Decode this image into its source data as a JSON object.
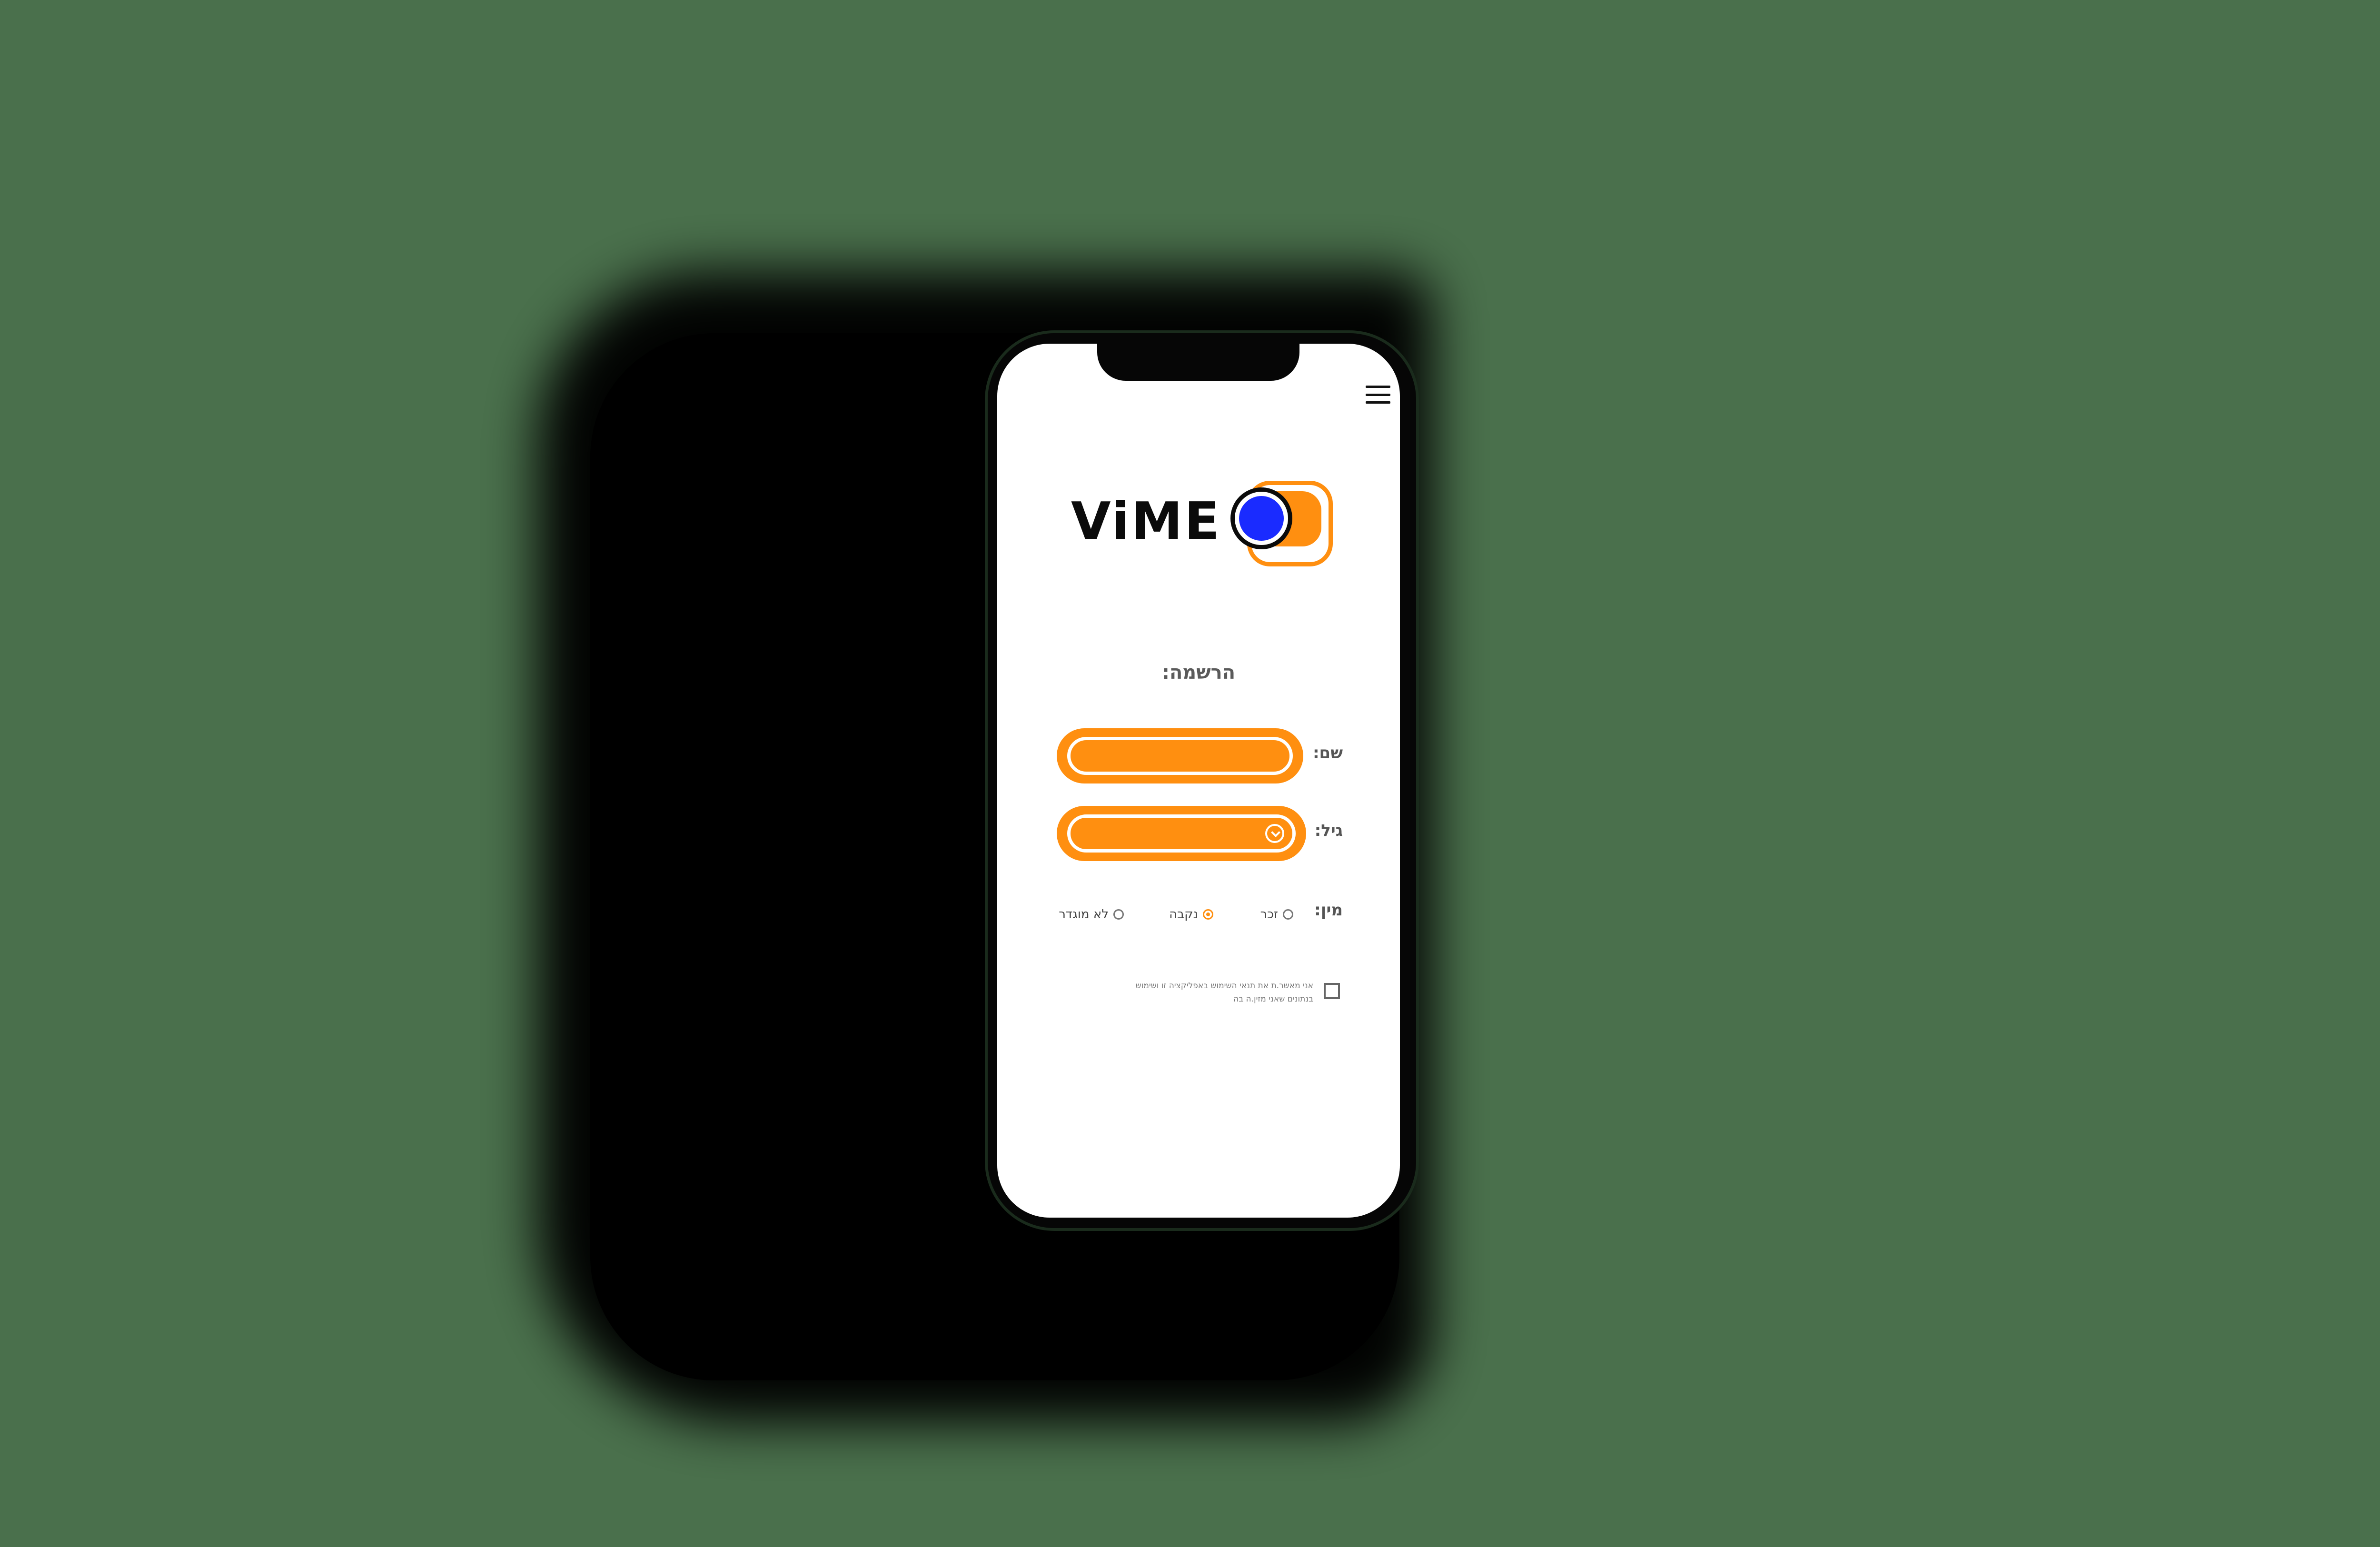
{
  "app": {
    "name": "ViME",
    "colors": {
      "background": "#4a704c",
      "accent": "#ff8f10",
      "knob": "#1a2bff",
      "text": "#555555"
    }
  },
  "header": {
    "menu_icon": "hamburger-menu-icon"
  },
  "logo": {
    "text": "ViME",
    "icon": "toggle-switch-icon"
  },
  "form": {
    "title": "הרשמה:",
    "name_label": "שם:",
    "name_value": "",
    "age_label": "גיל:",
    "age_value": "",
    "age_dropdown_icon": "chevron-down-circle-icon",
    "gender_label": "מין:",
    "gender_options": [
      {
        "label": "זכר",
        "selected": false
      },
      {
        "label": "נקבה",
        "selected": true
      },
      {
        "label": "לא מוגדר",
        "selected": false
      }
    ],
    "consent_text": "אני מאשר.ת את תנאי השימוש באפליקציה זו ושימוש בנתונים שאני מזין.ה בה",
    "consent_checked": false
  }
}
